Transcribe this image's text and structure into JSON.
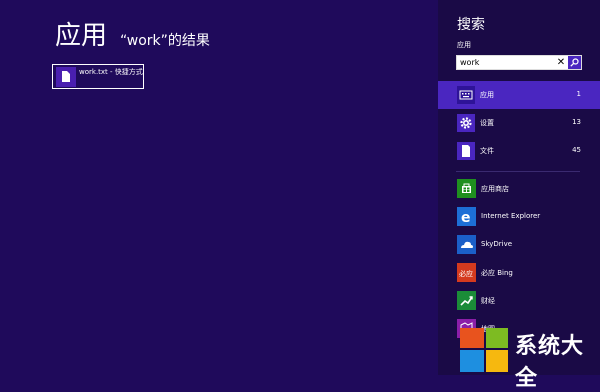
{
  "main": {
    "title": "应用",
    "query_text": "“work”的结果",
    "results": [
      {
        "label": "work.txt - 快捷方式",
        "icon": "document-icon"
      }
    ]
  },
  "pane": {
    "title": "搜索",
    "scope_label": "应用",
    "search": {
      "value": "work",
      "clear_glyph": "✕"
    },
    "scopes": [
      {
        "label": "应用",
        "count": "1",
        "icon": "keyboard-icon",
        "selected": true
      },
      {
        "label": "设置",
        "count": "13",
        "icon": "gear-icon",
        "selected": false
      },
      {
        "label": "文件",
        "count": "45",
        "icon": "document-icon",
        "selected": false
      }
    ],
    "apps": [
      {
        "label": "应用商店",
        "icon": "store-icon",
        "color": "#1f8f1f"
      },
      {
        "label": "Internet Explorer",
        "icon": "internet-explorer-icon",
        "color": "#1d6fd6"
      },
      {
        "label": "SkyDrive",
        "icon": "skydrive-icon",
        "color": "#1b5fc8"
      },
      {
        "label": "必应 Bing",
        "icon": "bing-icon",
        "color": "#d43a1e"
      },
      {
        "label": "财经",
        "icon": "finance-icon",
        "color": "#1b8c38"
      },
      {
        "label": "地图",
        "icon": "maps-icon",
        "color": "#8b1ea8"
      }
    ]
  },
  "watermark": {
    "text": "系统大全"
  },
  "colors": {
    "background": "#1f0a5b",
    "accent": "#4a26c0",
    "pane": "#1a0a46"
  }
}
